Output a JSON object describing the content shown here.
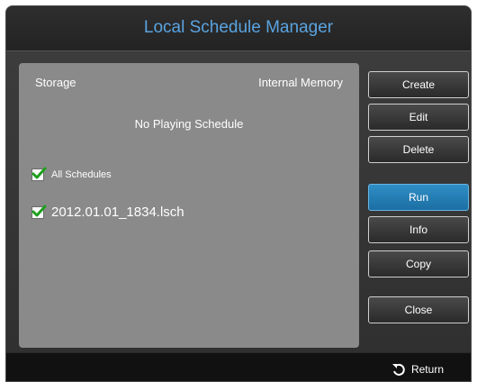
{
  "window": {
    "title": "Local Schedule Manager"
  },
  "panel": {
    "storage_label": "Storage",
    "storage_value": "Internal Memory",
    "status": "No Playing Schedule",
    "all_schedules_label": "All Schedules",
    "all_schedules_checked": true,
    "files": [
      {
        "name": "2012.01.01_1834.lsch",
        "checked": true
      }
    ]
  },
  "buttons": {
    "create": "Create",
    "edit": "Edit",
    "delete": "Delete",
    "run": "Run",
    "info": "Info",
    "copy": "Copy",
    "close": "Close"
  },
  "footer": {
    "return_label": "Return"
  },
  "icons": {
    "checkmark": "check-icon",
    "return": "return-icon"
  },
  "colors": {
    "title": "#5aa3e0",
    "accent_button": "#1f7fb8",
    "checkmark": "#1ea01e"
  }
}
